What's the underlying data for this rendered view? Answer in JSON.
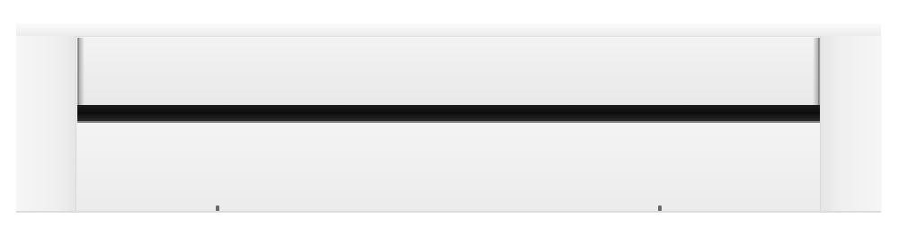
{
  "scene": {
    "subject": "baseboard-heater",
    "colors": {
      "body": "#efefef",
      "slot": "#111111",
      "background": "#ffffff"
    }
  }
}
